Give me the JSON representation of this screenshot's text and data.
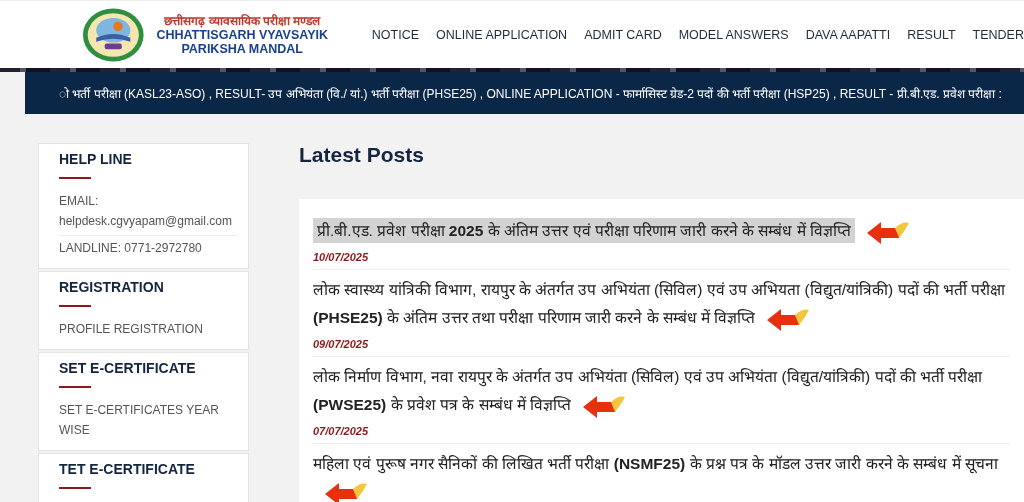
{
  "header": {
    "title_hindi": "छत्तीसगढ़ व्यावसायिक परीक्षा मण्डल",
    "title_english": "CHHATTISGARH VYAVSAYIK PARIKSHA MANDAL"
  },
  "nav": [
    "NOTICE",
    "ONLINE APPLICATION",
    "ADMIT CARD",
    "MODEL ANSWERS",
    "DAVA AAPATTI",
    "RESULT",
    "TENDER"
  ],
  "ticker": "ो भर्ती परीक्षा (KASL23-ASO) , RESULT- उप अभियंता (वि./ यां.) भर्ती परीक्षा (PHSE25) , ONLINE APPLICATION - फार्मासिस्ट ग्रेड-2 पदों की भर्ती परीक्षा (HSP25) , RESULT - प्री.बी.एड. प्रवेश परीक्षा :",
  "sidebar": [
    {
      "title": "HELP LINE",
      "items": [
        "EMAIL: helpdesk.cgvyapam@gmail.com",
        "LANDLINE: 0771-2972780"
      ]
    },
    {
      "title": "REGISTRATION",
      "items": [
        "PROFILE REGISTRATION"
      ]
    },
    {
      "title": "SET E-CERTIFICATE",
      "items": [
        "SET E-CERTIFICATES YEAR WISE"
      ]
    },
    {
      "title": "TET E-CERTIFICATE"
    }
  ],
  "main": {
    "heading": "Latest Posts",
    "posts": [
      {
        "title": "प्री.बी.एड. प्रवेश परीक्षा **2025** के अंतिम उत्तर एवं परीक्षा परिणाम जारी करने के सम्बंध में विज्ञप्ति",
        "date": "10/07/2025",
        "highlighted": true
      },
      {
        "title": "लोक स्वास्थ्य यांत्रिकी विभाग, रायपुर के अंतर्गत उप अभियंता (सिविल) एवं उप अभियता (विद्युत/यांत्रिकी) पदों की भर्ती परीक्षा **(PHSE25)** के अंतिम उत्तर तथा परीक्षा परिणाम जारी करने के सम्बंध में विज्ञप्ति",
        "date": "09/07/2025",
        "highlighted": false
      },
      {
        "title": "लोक निर्माण विभाग, नवा रायपुर के अंतर्गत उप अभियंता (सिविल) एवं उप अभियंता (विद्युत/यांत्रिकी) पदों की भर्ती परीक्षा **(PWSE25)** के प्रवेश पत्र के सम्बंध में विज्ञप्ति",
        "date": "07/07/2025",
        "highlighted": false
      },
      {
        "title": "महिला एवं पुरूष नगर सैनिकों की लिखित भर्ती परीक्षा **(NSMF25)** के प्रश्न पत्र के मॉडल उत्तर जारी करने के सम्बंध में सूचना",
        "highlighted": false
      }
    ]
  }
}
